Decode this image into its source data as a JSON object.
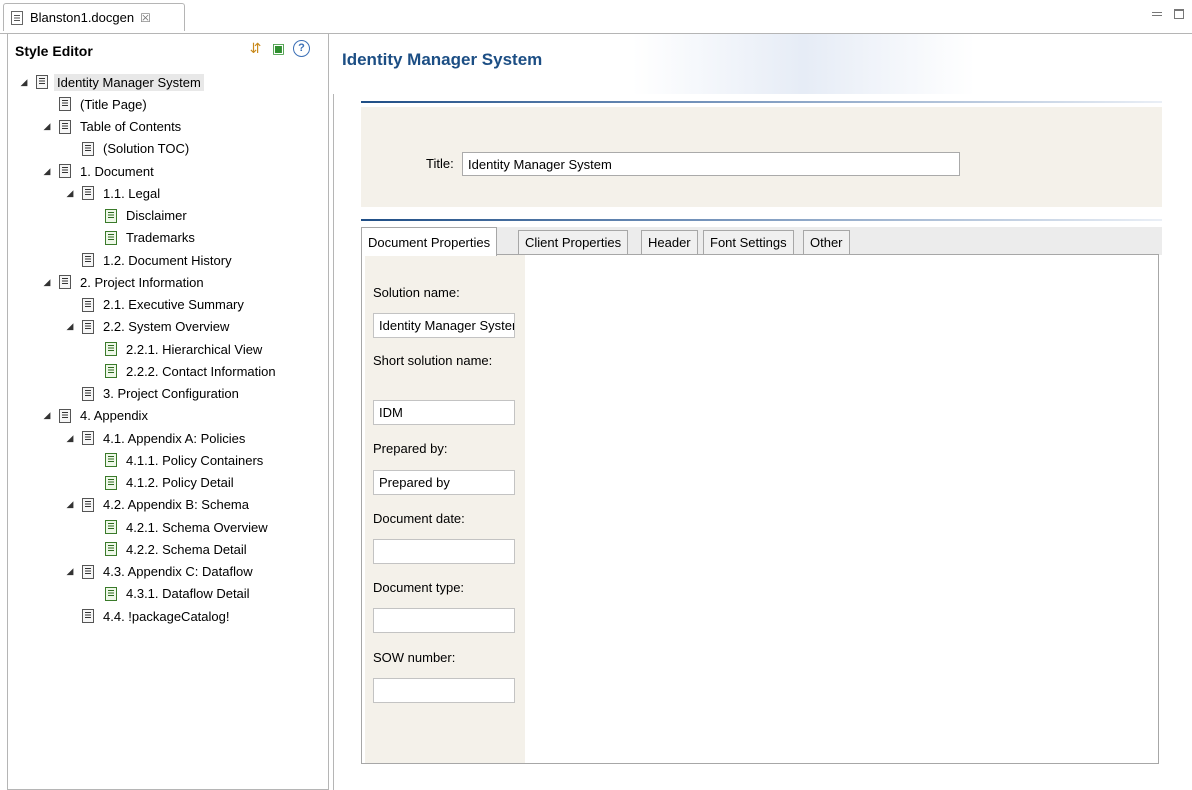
{
  "editor_tab": {
    "title": "Blanston1.docgen",
    "close": "☒"
  },
  "left": {
    "title": "Style Editor",
    "tree": [
      {
        "label": "Identity Manager System",
        "expanded": true
      },
      {
        "label": "(Title Page)",
        "expanded": null
      },
      {
        "label": "Table of Contents",
        "expanded": true
      },
      {
        "label": "(Solution TOC)",
        "expanded": null
      },
      {
        "label": "1. Document",
        "expanded": true
      },
      {
        "label": "1.1. Legal",
        "expanded": true
      },
      {
        "label": "Disclaimer",
        "expanded": null
      },
      {
        "label": "Trademarks",
        "expanded": null
      },
      {
        "label": "1.2. Document History",
        "expanded": null
      },
      {
        "label": "2. Project Information",
        "expanded": true
      },
      {
        "label": "2.1. Executive Summary",
        "expanded": null
      },
      {
        "label": "2.2. System Overview",
        "expanded": true
      },
      {
        "label": "2.2.1. Hierarchical View",
        "expanded": null
      },
      {
        "label": "2.2.2. Contact Information",
        "expanded": null
      },
      {
        "label": "3. Project Configuration",
        "expanded": null
      },
      {
        "label": "4. Appendix",
        "expanded": true
      },
      {
        "label": "4.1. Appendix A: Policies",
        "expanded": true
      },
      {
        "label": "4.1.1. Policy Containers",
        "expanded": null
      },
      {
        "label": "4.1.2. Policy Detail",
        "expanded": null
      },
      {
        "label": "4.2. Appendix B: Schema",
        "expanded": true
      },
      {
        "label": "4.2.1. Schema Overview",
        "expanded": null
      },
      {
        "label": "4.2.2. Schema Detail",
        "expanded": null
      },
      {
        "label": "4.3. Appendix C: Dataflow",
        "expanded": true
      },
      {
        "label": "4.3.1. Dataflow Detail",
        "expanded": null
      },
      {
        "label": "4.4. !packageCatalog!",
        "expanded": null
      }
    ],
    "selected_index": 0
  },
  "main": {
    "title": "Identity Manager System",
    "title_field": {
      "label": "Title:",
      "value": "Identity Manager System"
    },
    "tabs": [
      "Document Properties",
      "Client Properties",
      "Header",
      "Font Settings",
      "Other"
    ],
    "active_tab": 0,
    "fields": [
      {
        "label": "Solution name:",
        "value": "Identity Manager System"
      },
      {
        "label": "Short solution name:",
        "value": "IDM"
      },
      {
        "label": "Prepared by:",
        "value": "Prepared by"
      },
      {
        "label": "Document date:",
        "value": ""
      },
      {
        "label": "Document type:",
        "value": ""
      },
      {
        "label": "SOW number:",
        "value": ""
      }
    ]
  },
  "icons": {
    "merge": "merge-icon",
    "generate": "generate-icon",
    "help": "help-icon"
  }
}
